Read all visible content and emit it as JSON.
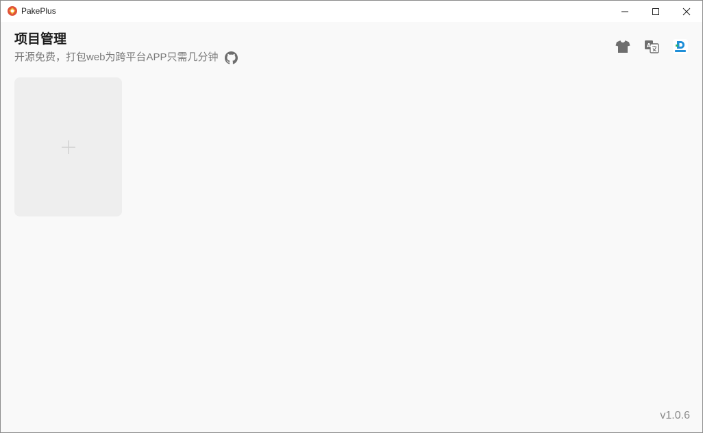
{
  "window": {
    "title": "PakePlus",
    "controls": {
      "minimize_icon": "minimize-icon",
      "maximize_icon": "maximize-icon",
      "close_icon": "close-icon"
    }
  },
  "header": {
    "title": "项目管理",
    "subtitle": "开源免费，打包web为跨平台APP只需几分钟",
    "subtitle_icon": "github-icon"
  },
  "toolbar": {
    "icons": [
      "shirt-icon",
      "translate-icon",
      "app-badge-icon"
    ]
  },
  "projects": {
    "add_card_icon": "plus-icon",
    "items": []
  },
  "footer": {
    "version": "v1.0.6"
  },
  "colors": {
    "background": "#f9f9f9",
    "card": "#eeeeee",
    "title_text": "#1c1c1c",
    "muted_text": "#7a7a7a",
    "icon_gray": "#6e6e6e",
    "badge_blue": "#1f8fd8",
    "badge_green": "#2fb36b",
    "app_icon_red": "#e0533a"
  }
}
